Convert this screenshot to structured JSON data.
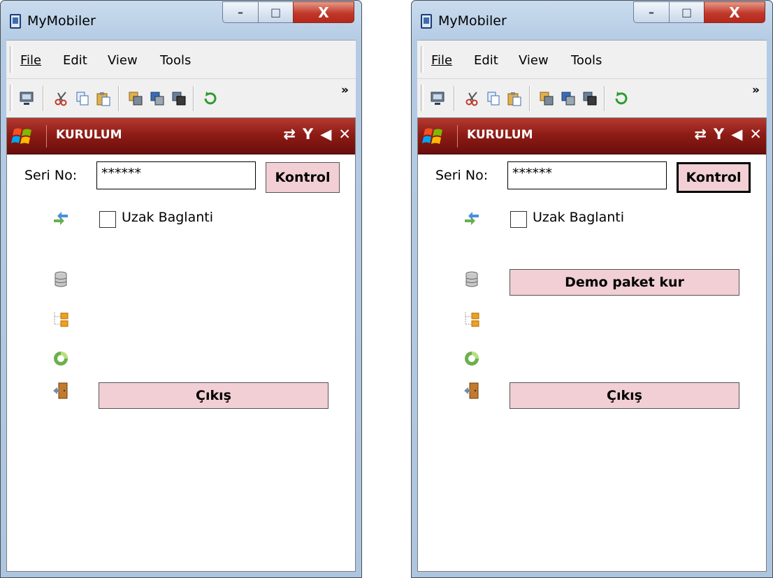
{
  "windows": [
    {
      "title": "MyMobiler",
      "menu": [
        "File",
        "Edit",
        "View",
        "Tools"
      ],
      "caption": {
        "minimize": "–",
        "maximize": "□",
        "close": "X"
      },
      "toolbar_overflow": "»",
      "wm_title": "KURULUM",
      "wm_close": "✕",
      "serial_label": "Seri No:",
      "serial_value": "******",
      "kontrol_label": "Kontrol",
      "remote_label": "Uzak Baglanti",
      "exit_label": "Çıkış"
    },
    {
      "title": "MyMobiler",
      "menu": [
        "File",
        "Edit",
        "View",
        "Tools"
      ],
      "caption": {
        "minimize": "–",
        "maximize": "□",
        "close": "X"
      },
      "toolbar_overflow": "»",
      "wm_title": "KURULUM",
      "wm_close": "✕",
      "serial_label": "Seri No:",
      "serial_value": "******",
      "kontrol_label": "Kontrol",
      "remote_label": "Uzak Baglanti",
      "demo_label": "Demo paket kur",
      "exit_label": "Çıkış"
    }
  ],
  "colors": {
    "button_fill": "#f1cfd4",
    "wm_bar": "#8f1c16"
  }
}
